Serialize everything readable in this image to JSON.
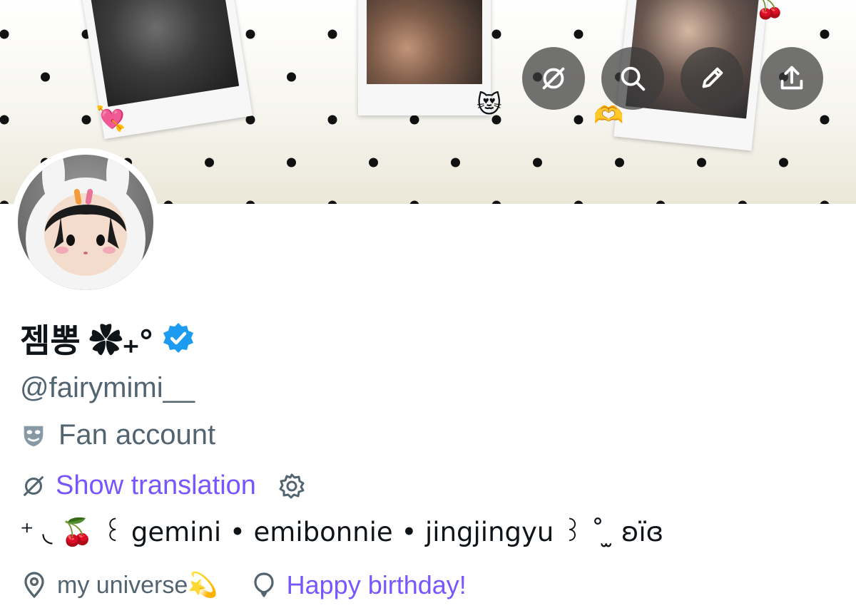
{
  "profile": {
    "display_name": "젬뽕 ✿₊°",
    "handle": "@fairymimi__",
    "label": "Fan account",
    "translate_link": "Show translation",
    "bio": "⁺ ◟ 🍒 ꒰ gemini • emibonnie • jingjingyu ꒱ ˚ ̫ ʚïɞ",
    "location": "my universe💫",
    "birthday": "Happy birthday!"
  },
  "header_buttons": [
    {
      "name": "translate-icon"
    },
    {
      "name": "search-icon"
    },
    {
      "name": "edit-icon"
    },
    {
      "name": "share-icon"
    }
  ],
  "colors": {
    "accent": "#7856ff",
    "verified": "#1d9bf0",
    "secondary_text": "#536471",
    "primary_text": "#0f1419"
  },
  "stickers": {
    "heart": "💘",
    "cat": "😻",
    "hands": "🫶",
    "cherries": "🍒"
  }
}
